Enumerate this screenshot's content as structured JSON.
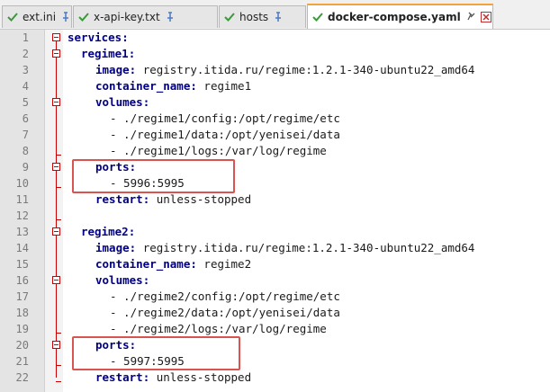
{
  "tabs": [
    {
      "label": "ext.ini",
      "active": false
    },
    {
      "label": "x-api-key.txt",
      "active": false
    },
    {
      "label": "hosts",
      "active": false
    },
    {
      "label": "docker-compose.yaml",
      "active": true
    }
  ],
  "lines": [
    {
      "num": "1",
      "key": "services",
      "rest": ""
    },
    {
      "num": "2",
      "key": "regime1",
      "rest": ""
    },
    {
      "num": "3",
      "key": "image",
      "rest": " registry.itida.ru/regime:1.2.1-340-ubuntu22_amd64"
    },
    {
      "num": "4",
      "key": "container_name",
      "rest": " regime1"
    },
    {
      "num": "5",
      "key": "volumes",
      "rest": ""
    },
    {
      "num": "6",
      "key": "",
      "rest": "- ./regime1/config:/opt/regime/etc"
    },
    {
      "num": "7",
      "key": "",
      "rest": "- ./regime1/data:/opt/yenisei/data"
    },
    {
      "num": "8",
      "key": "",
      "rest": "- ./regime1/logs:/var/log/regime"
    },
    {
      "num": "9",
      "key": "ports",
      "rest": ""
    },
    {
      "num": "10",
      "key": "",
      "rest": "- 5996:5995"
    },
    {
      "num": "11",
      "key": "restart",
      "rest": " unless-stopped"
    },
    {
      "num": "12",
      "key": "",
      "rest": ""
    },
    {
      "num": "13",
      "key": "regime2",
      "rest": ""
    },
    {
      "num": "14",
      "key": "image",
      "rest": " registry.itida.ru/regime:1.2.1-340-ubuntu22_amd64"
    },
    {
      "num": "15",
      "key": "container_name",
      "rest": " regime2"
    },
    {
      "num": "16",
      "key": "volumes",
      "rest": ""
    },
    {
      "num": "17",
      "key": "",
      "rest": "- ./regime2/config:/opt/regime/etc"
    },
    {
      "num": "18",
      "key": "",
      "rest": "- ./regime2/data:/opt/yenisei/data"
    },
    {
      "num": "19",
      "key": "",
      "rest": "- ./regime2/logs:/var/log/regime"
    },
    {
      "num": "20",
      "key": "ports",
      "rest": ""
    },
    {
      "num": "21",
      "key": "",
      "rest": "- 5997:5995"
    },
    {
      "num": "22",
      "key": "restart",
      "rest": " unless-stopped"
    }
  ],
  "colors": {
    "key": "#000080",
    "fold_marker": "#cc0000",
    "highlight_box": "#d9534f",
    "active_tab_accent": "#f2a33a"
  }
}
